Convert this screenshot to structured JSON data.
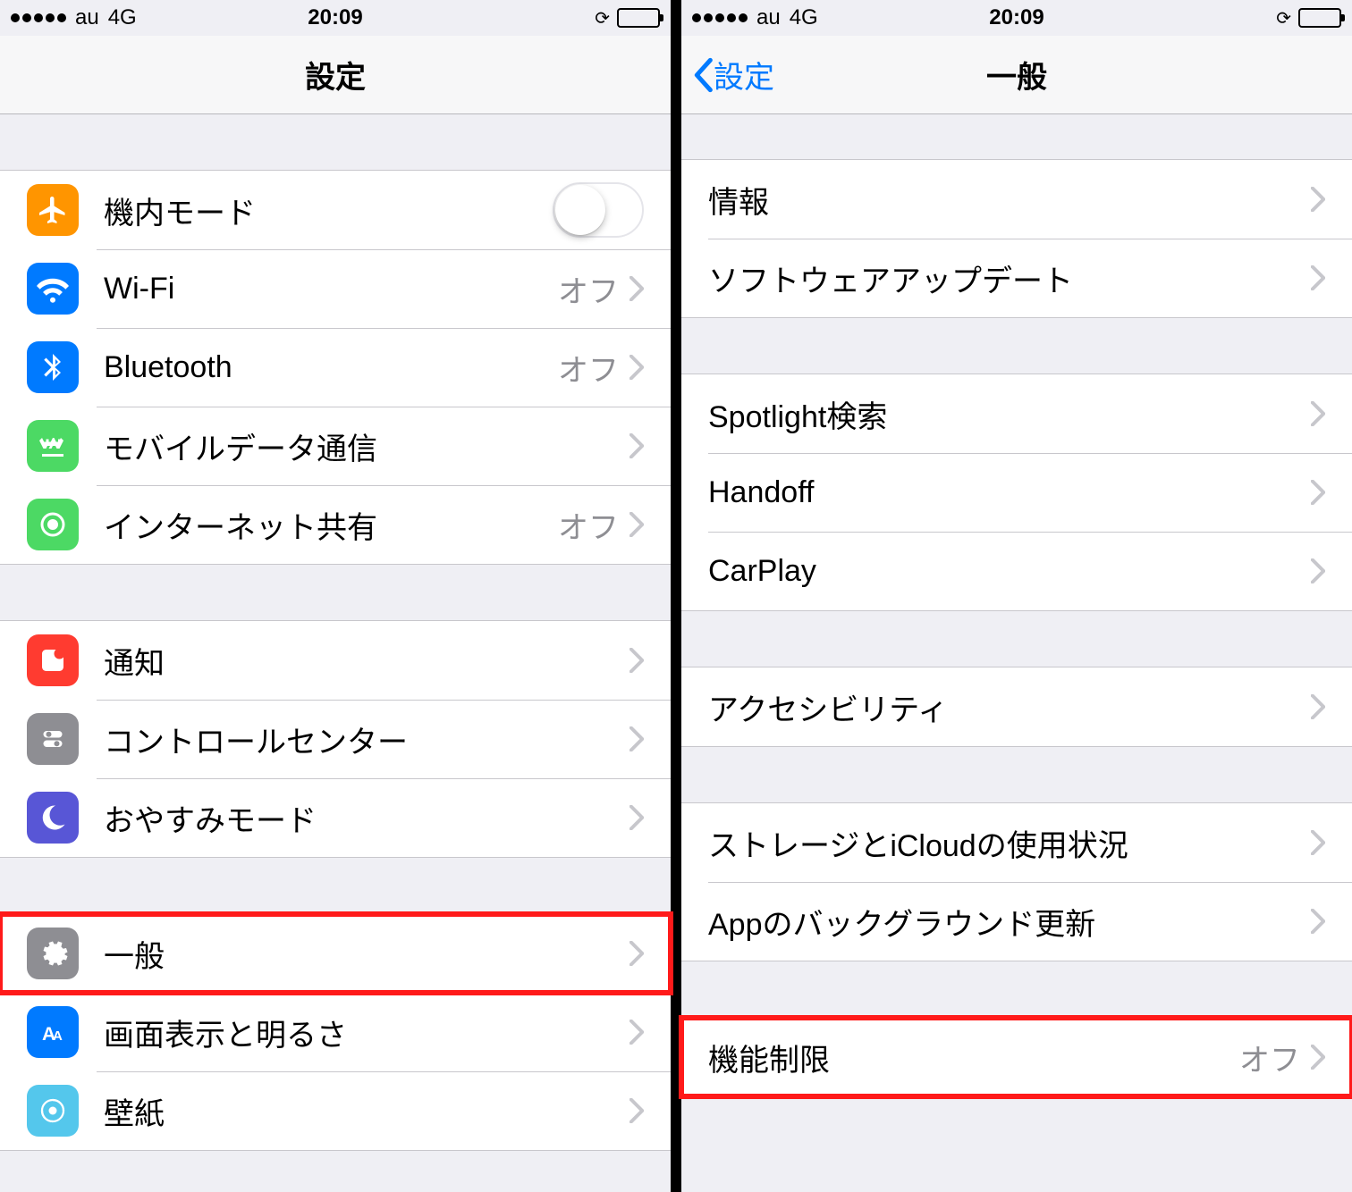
{
  "status": {
    "carrier": "au",
    "network": "4G",
    "time": "20:09"
  },
  "left": {
    "title": "設定",
    "rows": {
      "airplane": "機内モード",
      "wifi": {
        "label": "Wi-Fi",
        "value": "オフ"
      },
      "bluetooth": {
        "label": "Bluetooth",
        "value": "オフ"
      },
      "cellular": "モバイルデータ通信",
      "hotspot": {
        "label": "インターネット共有",
        "value": "オフ"
      },
      "notifications": "通知",
      "control_center": "コントロールセンター",
      "dnd": "おやすみモード",
      "general": "一般",
      "display": "画面表示と明るさ",
      "wallpaper": "壁紙"
    }
  },
  "right": {
    "back": "設定",
    "title": "一般",
    "rows": {
      "about": "情報",
      "software_update": "ソフトウェアアップデート",
      "spotlight": "Spotlight検索",
      "handoff": "Handoff",
      "carplay": "CarPlay",
      "accessibility": "アクセシビリティ",
      "storage": "ストレージとiCloudの使用状況",
      "background_refresh": "Appのバックグラウンド更新",
      "restrictions": {
        "label": "機能制限",
        "value": "オフ"
      }
    }
  }
}
